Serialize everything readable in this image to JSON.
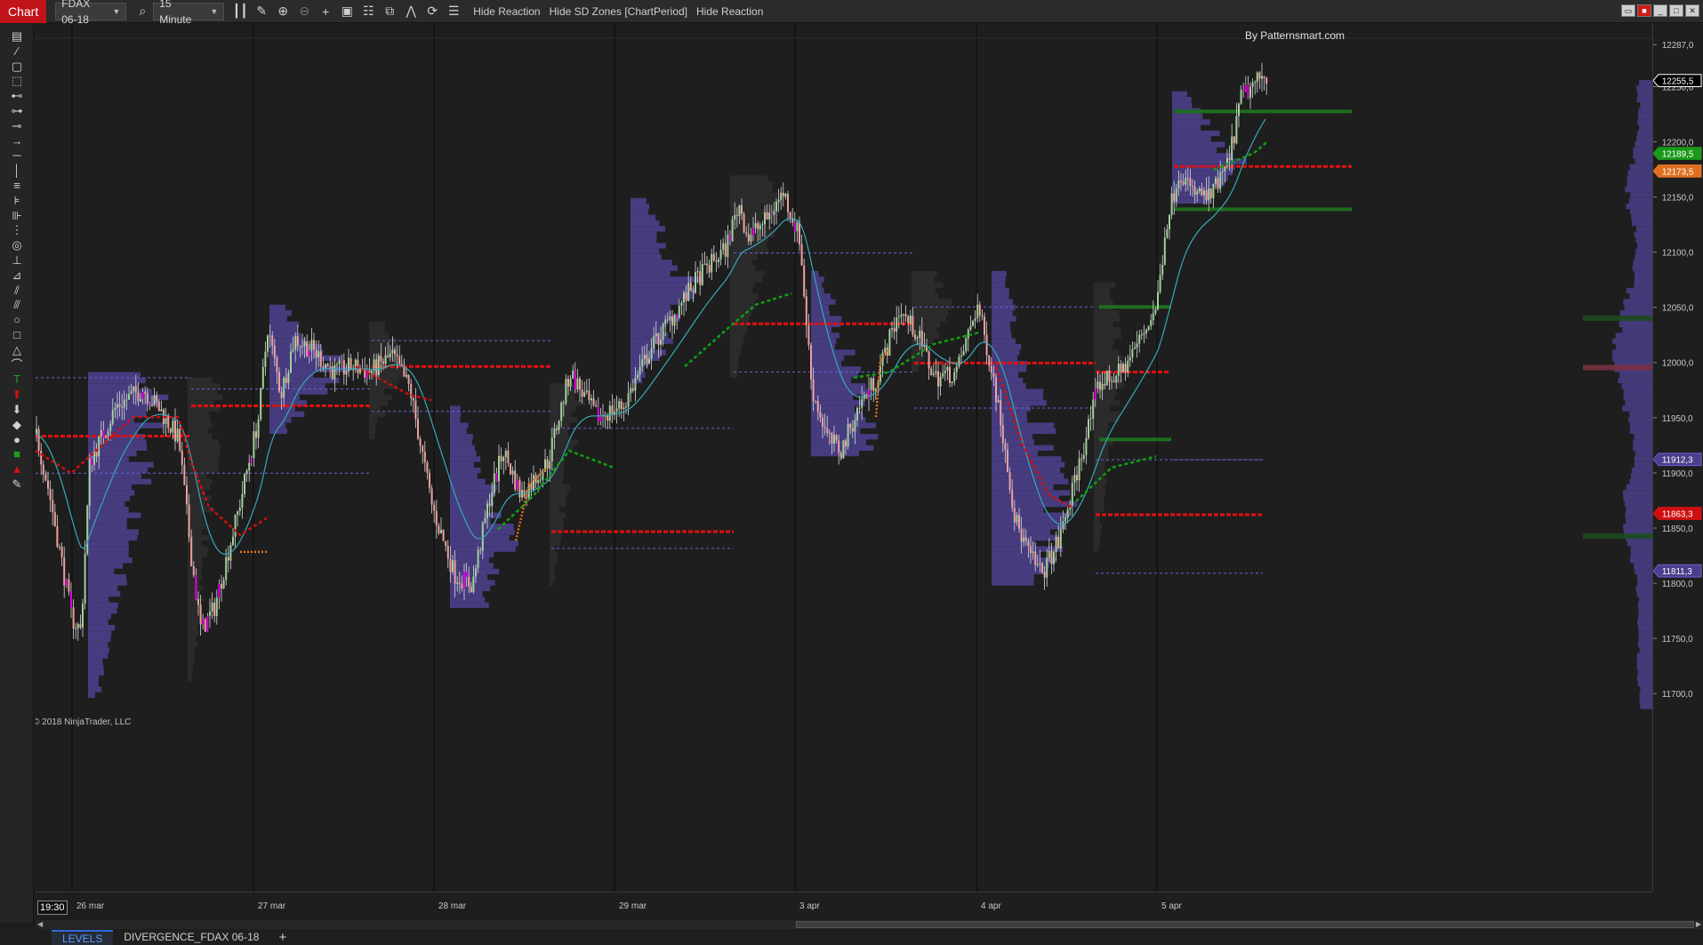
{
  "toolbar": {
    "chart_tab": "Chart",
    "instrument": "FDAX 06-18",
    "period": "15 Minute",
    "buttons": [
      "Hide Reaction",
      "Hide SD Zones [ChartPeriod]",
      "Hide Reaction"
    ],
    "icons": [
      "magnify-icon",
      "bar-type-icon",
      "pencil-icon",
      "zoom-in-icon",
      "zoom-out-icon",
      "crosshair-icon",
      "data-box-icon",
      "strategy-icon",
      "indicator-icon",
      "draw-tools-icon",
      "reload-icon",
      "properties-icon"
    ]
  },
  "watermark": "By Patternsmart.com",
  "copyright": "© 2018 NinjaTrader, LLC",
  "session_time": "19:30",
  "colors": {
    "background": "#1e1e1e",
    "profile": "#4a3f8a",
    "bull_candle": "#9fd29a",
    "bear_candle": "#f0a0a0",
    "highlight_candle": "#e000e0",
    "poc_line": "#e01010",
    "level_green": "#1e6e1e",
    "dashed_level": "#6a63d8",
    "ema_line": "#38a8b8",
    "trail_red": "#d01010",
    "trail_green": "#10a010",
    "trail_orange": "#e07020"
  },
  "price_axis": {
    "ticks": [
      "12287,0",
      "12250,0",
      "12200,0",
      "12150,0",
      "12100,0",
      "12050,0",
      "12000,0",
      "11950,0",
      "11900,0",
      "11850,0",
      "11800,0",
      "11750,0",
      "11700,0"
    ],
    "markers": [
      {
        "label": "12255,5",
        "color": "#000000",
        "text_color": "#ffffff",
        "border": "#ffffff"
      },
      {
        "label": "12189,5",
        "color": "#1a9a1a",
        "text_color": "#ffffff",
        "border": "#1a9a1a"
      },
      {
        "label": "12173,5",
        "color": "#e07020",
        "text_color": "#ffffff",
        "border": "#e07020"
      },
      {
        "label": "11912,3",
        "color": "#4a3f8a",
        "text_color": "#ffffff",
        "border": "#6a63d8"
      },
      {
        "label": "11863,3",
        "color": "#d01010",
        "text_color": "#ffffff",
        "border": "#d01010"
      },
      {
        "label": "11811,3",
        "color": "#4a3f8a",
        "text_color": "#ffffff",
        "border": "#6a63d8"
      }
    ]
  },
  "time_axis": [
    "26 mar",
    "27 mar",
    "28 mar",
    "29 mar",
    "3 apr",
    "4 apr",
    "5 apr"
  ],
  "bottom_tabs": [
    "LEVELS",
    "DIVERGENCE_FDAX 06-18"
  ],
  "drawing_tools": [
    "ruler-icon",
    "fib-icon",
    "box-icon",
    "box2-icon",
    "line-icon",
    "ray-icon",
    "extended-line-icon",
    "arrow-line-icon",
    "horizontal-line-icon",
    "vertical-line-icon",
    "fib-retracement-icon",
    "fib-extension-icon",
    "fib-timezone-icon",
    "fib-circle-icon",
    "andrews-icon",
    "gann-icon",
    "regression-icon",
    "channel-icon",
    "ellipse-icon",
    "rectangle-icon",
    "triangle-icon",
    "arc-icon",
    "text-icon",
    "arrow-up-icon",
    "arrow-down-icon",
    "diamond-icon",
    "dot-icon",
    "square-icon",
    "triangle-up-icon",
    "triangle-down-icon",
    "pencil-draw-icon"
  ]
}
